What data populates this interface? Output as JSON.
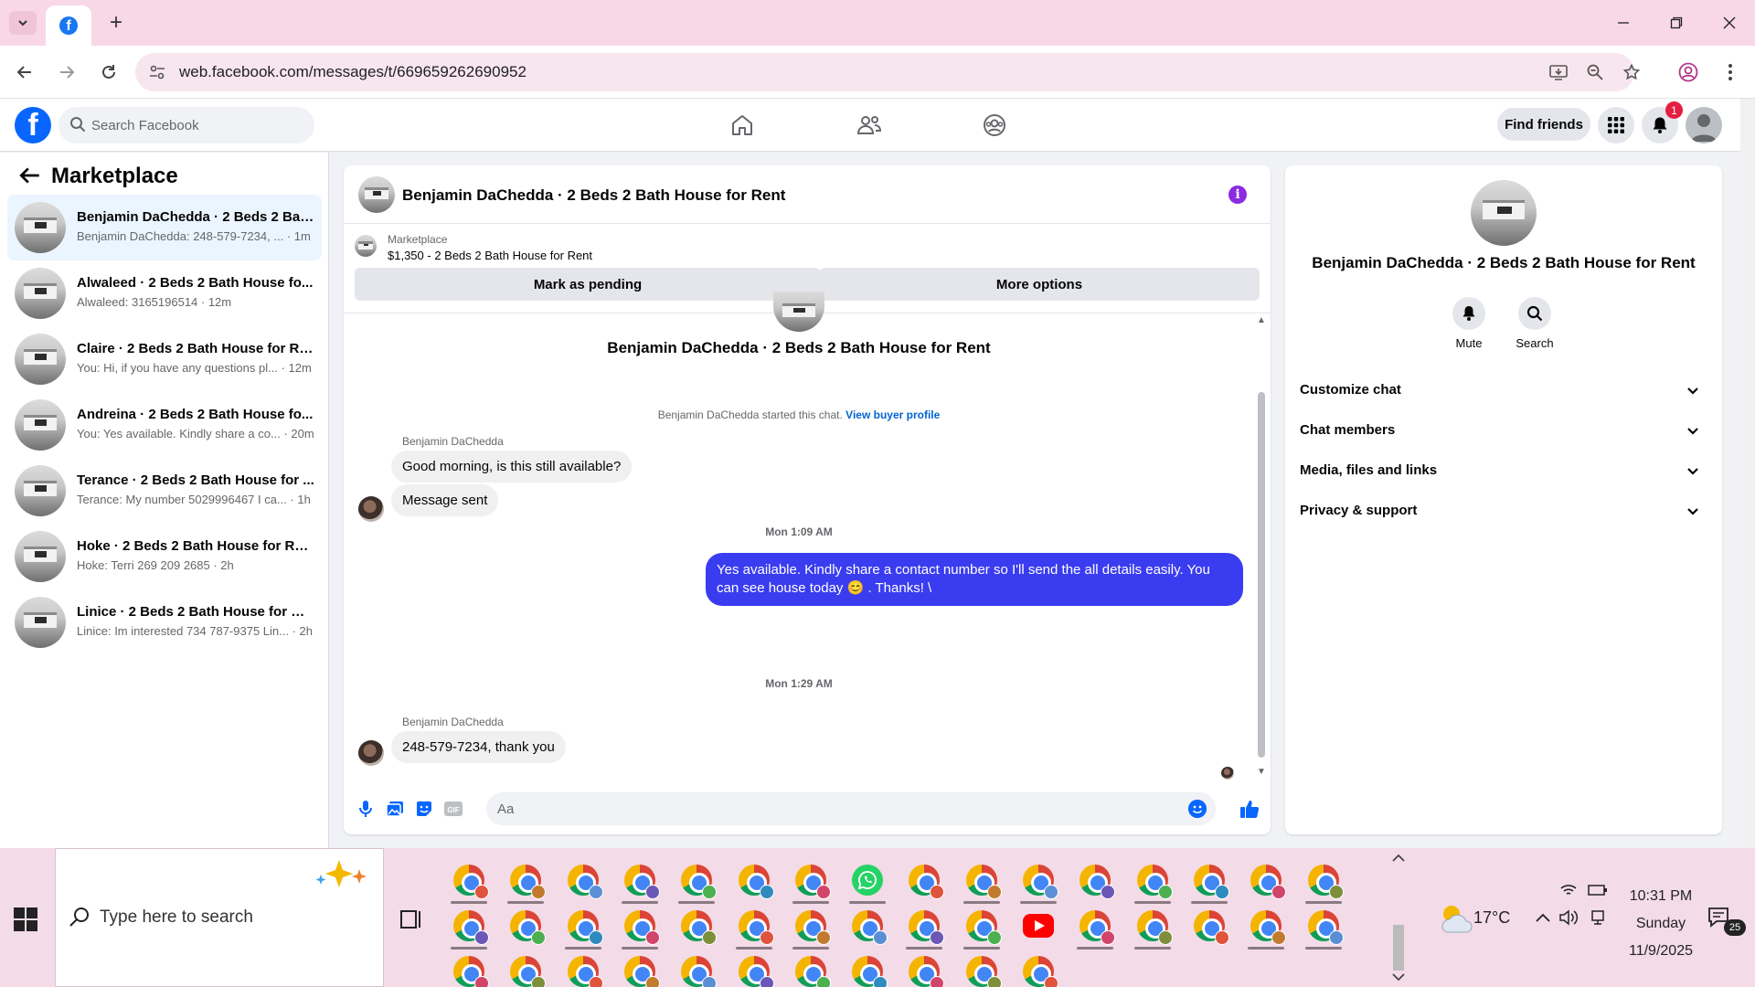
{
  "browser": {
    "tab_icon": "facebook-favicon",
    "url": "web.facebook.com/messages/t/669659262690952"
  },
  "fb_header": {
    "logo_letter": "f",
    "search_placeholder": "Search Facebook",
    "find_friends_label": "Find friends",
    "notification_count": "1"
  },
  "sidebar": {
    "title": "Marketplace",
    "conversations": [
      {
        "title": "Benjamin DaChedda · 2 Beds 2 Bat...",
        "preview": "Benjamin DaChedda: 248-579-7234, ... · 1m",
        "active": true
      },
      {
        "title": "Alwaleed · 2 Beds 2 Bath House fo...",
        "preview": "Alwaleed: 3165196514 · 12m",
        "active": false
      },
      {
        "title": "Claire · 2 Beds 2 Bath House for Re...",
        "preview": "You: Hi, if you have any questions pl... · 12m",
        "active": false
      },
      {
        "title": "Andreina · 2 Beds 2 Bath House fo...",
        "preview": "You: Yes available. Kindly share a co... · 20m",
        "active": false
      },
      {
        "title": "Terance · 2 Beds 2 Bath House for ...",
        "preview": "Terance: My number 5029996467 I ca... · 1h",
        "active": false
      },
      {
        "title": "Hoke · 2 Beds 2 Bath House for Rent",
        "preview": "Hoke: Terri 269 209 2685 · 2h",
        "active": false
      },
      {
        "title": "Linice · 2 Beds 2 Bath House for Re...",
        "preview": "Linice: Im interested 734 787-9375 Lin... · 2h",
        "active": false
      }
    ]
  },
  "chat": {
    "header_title": "Benjamin DaChedda · 2 Beds 2 Bath House for Rent",
    "listing_category": "Marketplace",
    "listing_info": "$1,350 - 2 Beds 2 Bath House for Rent",
    "mark_pending_label": "Mark as pending",
    "more_options_label": "More options",
    "thread_title": "Benjamin DaChedda · 2 Beds 2 Bath House for Rent",
    "started_text": "Benjamin DaChedda started this chat.",
    "view_buyer_label": "View buyer profile",
    "sender1": "Benjamin DaChedda",
    "msg1": "Good morning, is this still available?",
    "msg2": "Message sent",
    "time1": "Mon 1:09 AM",
    "out_msg": "Yes available. Kindly share a contact number so I'll send the all details easily. You can see house today 😊 . Thanks! \\",
    "time2": "Mon 1:29 AM",
    "sender2": "Benjamin DaChedda",
    "msg3": "248-579-7234, thank you",
    "composer_placeholder": "Aa"
  },
  "info_panel": {
    "title": "Benjamin DaChedda · 2 Beds 2 Bath House for Rent",
    "mute_label": "Mute",
    "search_label": "Search",
    "rows": [
      "Customize chat",
      "Chat members",
      "Media, files and links",
      "Privacy & support"
    ]
  },
  "taskbar": {
    "search_placeholder": "Type here to search",
    "temperature": "17°C",
    "time": "10:31 PM",
    "day": "Sunday",
    "date": "11/9/2025",
    "notification_count": "25"
  },
  "colors": {
    "fb_blue": "#0866ff",
    "outgoing_bubble": "#3a3cf0",
    "active_conversation": "#ebf5ff",
    "info_icon": "#8a2be2",
    "notification_red": "#e41e3f",
    "chrome_tab_bar": "#f8d7e6",
    "taskbar": "#f3dbe7"
  }
}
